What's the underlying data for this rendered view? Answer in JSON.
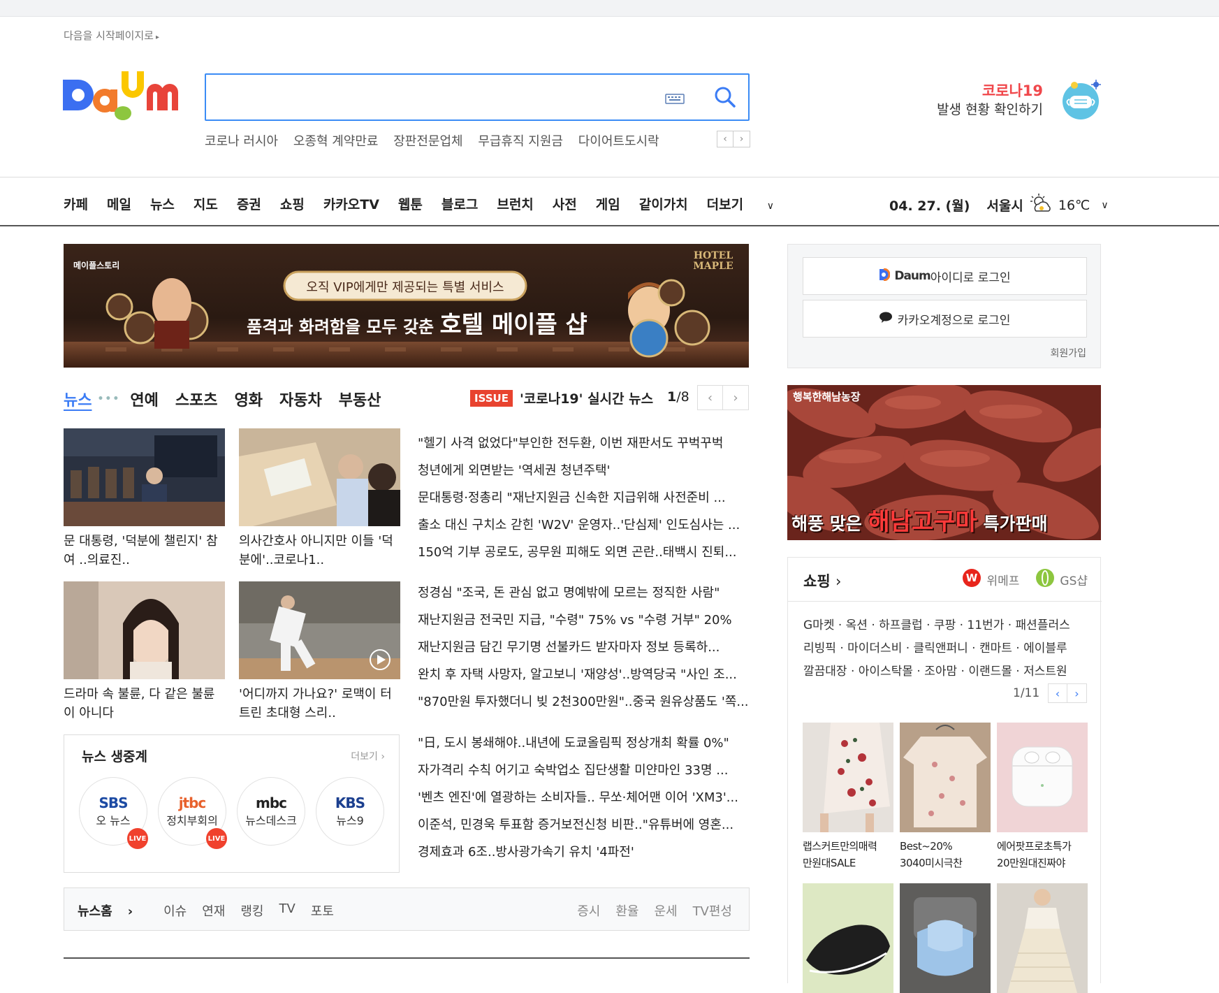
{
  "header": {
    "start_page": "다음을 시작페이지로",
    "suggestions": [
      "코로나 러시아",
      "오종혁 계약만료",
      "장판전문업체",
      "무급휴직 지원금",
      "다이어트도시락"
    ],
    "corona_title": "코로나19",
    "corona_sub": "발생 현황 확인하기"
  },
  "gnb": {
    "items": [
      "카페",
      "메일",
      "뉴스",
      "지도",
      "증권",
      "쇼핑",
      "카카오TV",
      "웹툰",
      "블로그",
      "브런치",
      "사전",
      "게임",
      "같이가치",
      "더보기"
    ],
    "date": "04. 27. (월)",
    "city": "서울시",
    "temp": "16℃"
  },
  "banner": {
    "brand": "메이플스토리",
    "hotel": "HOTEL MAPLE",
    "headline_top": "오직 VIP에게만 제공되는 특별 서비스",
    "headline_main_a": "품격과 화려함을 모두 갖춘 ",
    "headline_main_b": "호텔 메이플 샵"
  },
  "news": {
    "tabs": [
      "뉴스",
      "연예",
      "스포츠",
      "영화",
      "자동차",
      "부동산"
    ],
    "issue_badge": "ISSUE",
    "issue_text": "'코로나19' 실시간 뉴스",
    "issue_page_current": "1",
    "issue_page_total": "/8",
    "thumbs": [
      {
        "caption": "문 대통령, '덕분에 챌린지' 참여 ..의료진.."
      },
      {
        "caption": "의사간호사 아니지만 이들 '덕분에'..코로나1.."
      },
      {
        "caption": "드라마 속 불륜, 다 같은 불륜이 아니다"
      },
      {
        "caption": "'어디까지 가나요?' 로맥이 터트린 초대형 스리.."
      }
    ],
    "group1": [
      "\"헬기 사격 없었다\"부인한 전두환, 이번 재판서도 꾸벅꾸벅",
      "청년에게 외면받는 '역세권 청년주택'",
      "문대통령·정총리 \"재난지원금 신속한 지급위해 사전준비 ...",
      "출소 대신 구치소 갇힌 'W2V' 운영자..'단심제' 인도심사는 ...",
      "150억 기부 공로도, 공무원 피해도 외면 곤란..태백시 진퇴..."
    ],
    "group2": [
      "정경심 \"조국, 돈 관심 없고 명예밖에 모르는 정직한 사람\"",
      "재난지원금 전국민 지급, \"수령\" 75% vs \"수령 거부\" 20%",
      "재난지원금 담긴 무기명 선불카드 받자마자 정보 등록하...",
      "완치 후 자택 사망자, 알고보니 '재양성'..방역당국 \"사인 조...",
      "\"870만원 투자했더니 빚 2천300만원\"..중국 원유상품도 '쪽..."
    ],
    "group3": [
      "\"日, 도시 봉쇄해야..내년에 도쿄올림픽 정상개최 확률 0%\"",
      "자가격리 수칙 어기고 숙박업소 집단생활 미얀마인 33명 ...",
      "'벤츠 엔진'에 열광하는 소비자들.. 무쏘·체어맨 이어 'XM3'...",
      "이준석, 민경욱 투표함 증거보전신청 비판..\"유튜버에 영혼...",
      "경제효과 6조..방사광가속기 유치 '4파전'"
    ]
  },
  "live": {
    "title": "뉴스 생중계",
    "more": "더보기",
    "live_label": "LIVE",
    "channels": [
      {
        "logo": "SBS",
        "name": "오 뉴스",
        "live": true,
        "color": "#1c4aa3"
      },
      {
        "logo": "jtbc",
        "name": "정치부회의",
        "live": true,
        "color": "#e8612c"
      },
      {
        "logo": "mbc",
        "name": "뉴스데스크",
        "live": false,
        "color": "#222222"
      },
      {
        "logo": "KBS",
        "name": "뉴스9",
        "live": false,
        "color": "#1b3f8f"
      }
    ]
  },
  "newsbar": {
    "left": [
      "뉴스홈",
      "이슈",
      "연재",
      "랭킹",
      "TV",
      "포토"
    ],
    "right": [
      "증시",
      "환율",
      "운세",
      "TV편성"
    ]
  },
  "login": {
    "daum_brand": "Daum",
    "daum_label": "아이디로 로그인",
    "kakao_label": "카카오계정으로 로그인",
    "join": "회원가입"
  },
  "ad": {
    "farm": "행복한해남농장",
    "tagline_a": "해풍 맞은 ",
    "tagline_b": "해남고구마",
    "tagline_c": " 특가판매"
  },
  "shopping": {
    "title": "쇼핑",
    "brand1": "위메프",
    "brand2": "GS샵",
    "links": [
      "G마켓 · 옥션 · 하프클럽 · 쿠팡 · 11번가 · 패션플러스",
      "리빙픽 · 마이더스비 · 클릭앤퍼니 · 캔마트 · 에이블루",
      "깔끔대장 · 아이스탁몰 · 조아맘 · 이랜드몰 · 저스트원"
    ],
    "page": "1/11",
    "products": [
      {
        "line1": "랩스커트만의매력",
        "line2": "만원대SALE"
      },
      {
        "line1": "Best~20%",
        "line2": "3040미시극찬"
      },
      {
        "line1": "에어팟프로초특가",
        "line2": "20만원대진짜야"
      }
    ]
  },
  "colors": {
    "accent": "#3b8cf5",
    "issue_red": "#e8432f",
    "corona_red": "#f0474b"
  }
}
